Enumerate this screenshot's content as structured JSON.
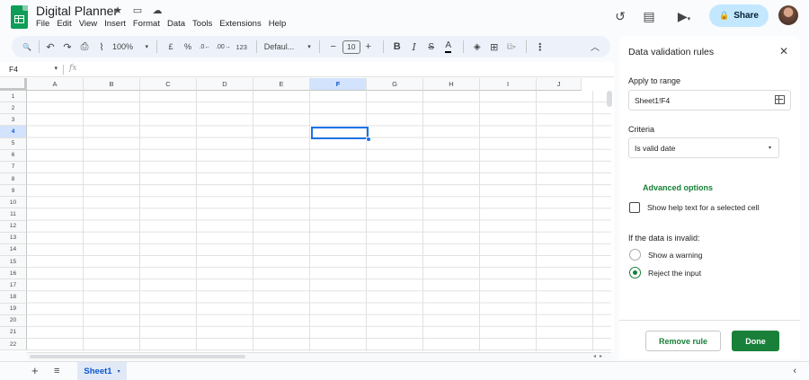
{
  "app": {
    "title": "Digital Planner",
    "menu": [
      "File",
      "Edit",
      "View",
      "Insert",
      "Format",
      "Data",
      "Tools",
      "Extensions",
      "Help"
    ],
    "share_label": "Share"
  },
  "icons": {
    "star": "★",
    "folder": "▭",
    "cloud": "☁",
    "history": "↺",
    "comment": "▤",
    "meet": "▶",
    "lock": "🔒",
    "search": "🔍",
    "undo": "↶",
    "redo": "↷",
    "print": "⎙",
    "paint": "⌇",
    "strike": "S",
    "fill": "◈",
    "borders": "⊞",
    "merge": "⧉",
    "more": "⋮",
    "collapse": "︿",
    "close": "✕",
    "chevron": "▾",
    "add": "+",
    "menu": "≡",
    "side": "‹"
  },
  "toolbar": {
    "zoom": "100%",
    "currency": "£",
    "percent": "%",
    "dec_decrease": ".0←",
    "dec_increase": ".00→",
    "number_format": "123",
    "font": "Defaul...",
    "font_size": "10",
    "minus": "−",
    "plus": "+",
    "bold": "B",
    "italic": "I",
    "text_color": "A"
  },
  "formula_bar": {
    "name_box": "F4",
    "fx": "fx"
  },
  "grid": {
    "columns": [
      "A",
      "B",
      "C",
      "D",
      "E",
      "F",
      "G",
      "H",
      "I",
      "J"
    ],
    "rows": [
      "1",
      "2",
      "3",
      "4",
      "5",
      "6",
      "7",
      "8",
      "9",
      "10",
      "11",
      "12",
      "13",
      "14",
      "15",
      "16",
      "17",
      "18",
      "19",
      "20",
      "21",
      "22"
    ],
    "selected_column": "F",
    "selected_row": "4"
  },
  "sheets": {
    "active": "Sheet1"
  },
  "panel": {
    "title": "Data validation rules",
    "apply_label": "Apply to range",
    "range_value": "Sheet1!F4",
    "criteria_label": "Criteria",
    "criteria_value": "Is valid date",
    "advanced": "Advanced options",
    "help_text_label": "Show help text for a selected cell",
    "invalid_label": "If the data is invalid:",
    "opt_warning": "Show a warning",
    "opt_reject": "Reject the input",
    "remove_btn": "Remove rule",
    "done_btn": "Done"
  },
  "colors": {
    "accent_green": "#188038",
    "share_bg": "#c2e7ff",
    "selection_blue": "#1a73e8"
  }
}
